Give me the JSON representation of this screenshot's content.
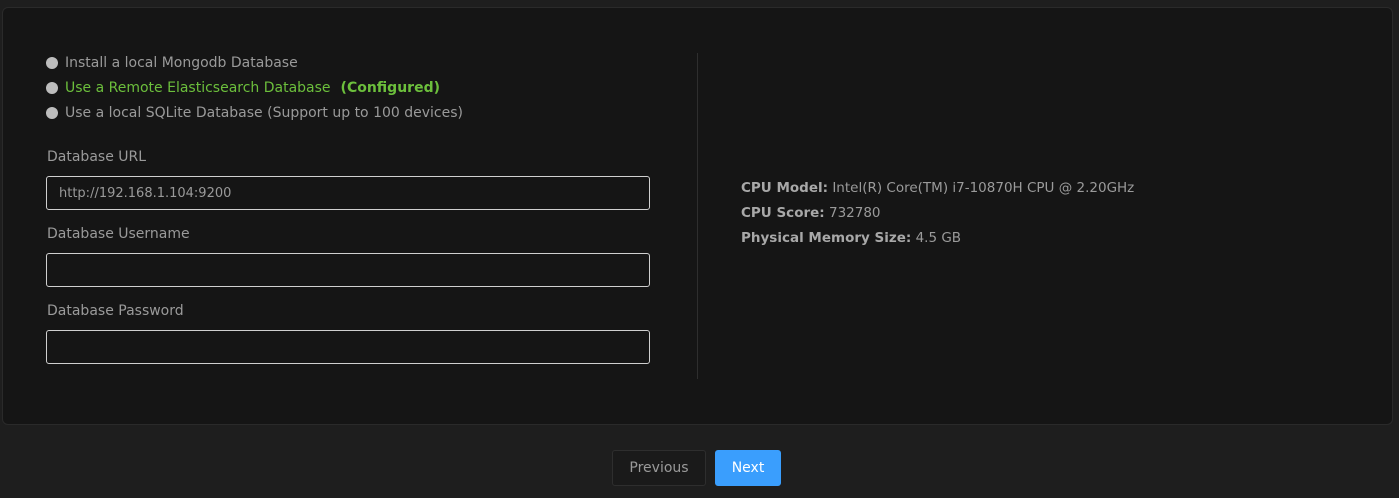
{
  "database_options": [
    {
      "label": "Install a local Mongodb Database",
      "badge": ""
    },
    {
      "label": "Use a Remote Elasticsearch Database",
      "badge": "(Configured)"
    },
    {
      "label": "Use a local SQLite Database (Support up to 100 devices)",
      "badge": ""
    }
  ],
  "form": {
    "url_label": "Database URL",
    "url_value": "http://192.168.1.104:9200",
    "username_label": "Database Username",
    "username_value": "",
    "password_label": "Database Password",
    "password_value": ""
  },
  "system_info": {
    "cpu_model_key": "CPU Model:",
    "cpu_model_value": "Intel(R) Core(TM) i7-10870H CPU @ 2.20GHz",
    "cpu_score_key": "CPU Score:",
    "cpu_score_value": "732780",
    "memory_key": "Physical Memory Size:",
    "memory_value": "4.5 GB"
  },
  "buttons": {
    "previous": "Previous",
    "next": "Next"
  },
  "colors": {
    "accent_green": "#6cbf3c",
    "primary_blue": "#3a9efd"
  }
}
